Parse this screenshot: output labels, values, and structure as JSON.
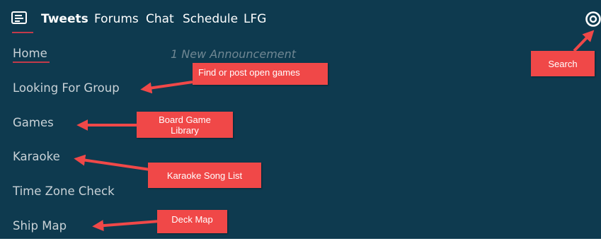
{
  "nav": {
    "tabs": [
      {
        "label": "Tweets",
        "active": true
      },
      {
        "label": "Forums"
      },
      {
        "label": "Chat"
      },
      {
        "label": "Schedule"
      },
      {
        "label": "LFG"
      }
    ],
    "logo_icon": "message-board-icon",
    "search_icon": "search-icon"
  },
  "menu": {
    "items": [
      {
        "label": "Home"
      },
      {
        "label": "Looking For Group"
      },
      {
        "label": "Games"
      },
      {
        "label": "Karaoke"
      },
      {
        "label": "Time Zone Check"
      },
      {
        "label": "Ship Map"
      }
    ]
  },
  "announcement": "1 New Announcement",
  "callouts": {
    "search": "Search",
    "lfg": "Find or post open games",
    "games_line1": "Board Game",
    "games_line2": "Library",
    "karaoke": "Karaoke Song List",
    "deck": "Deck Map"
  },
  "colors": {
    "background": "#0e3a4f",
    "accent": "#c23a4a",
    "callout": "#f04848"
  }
}
